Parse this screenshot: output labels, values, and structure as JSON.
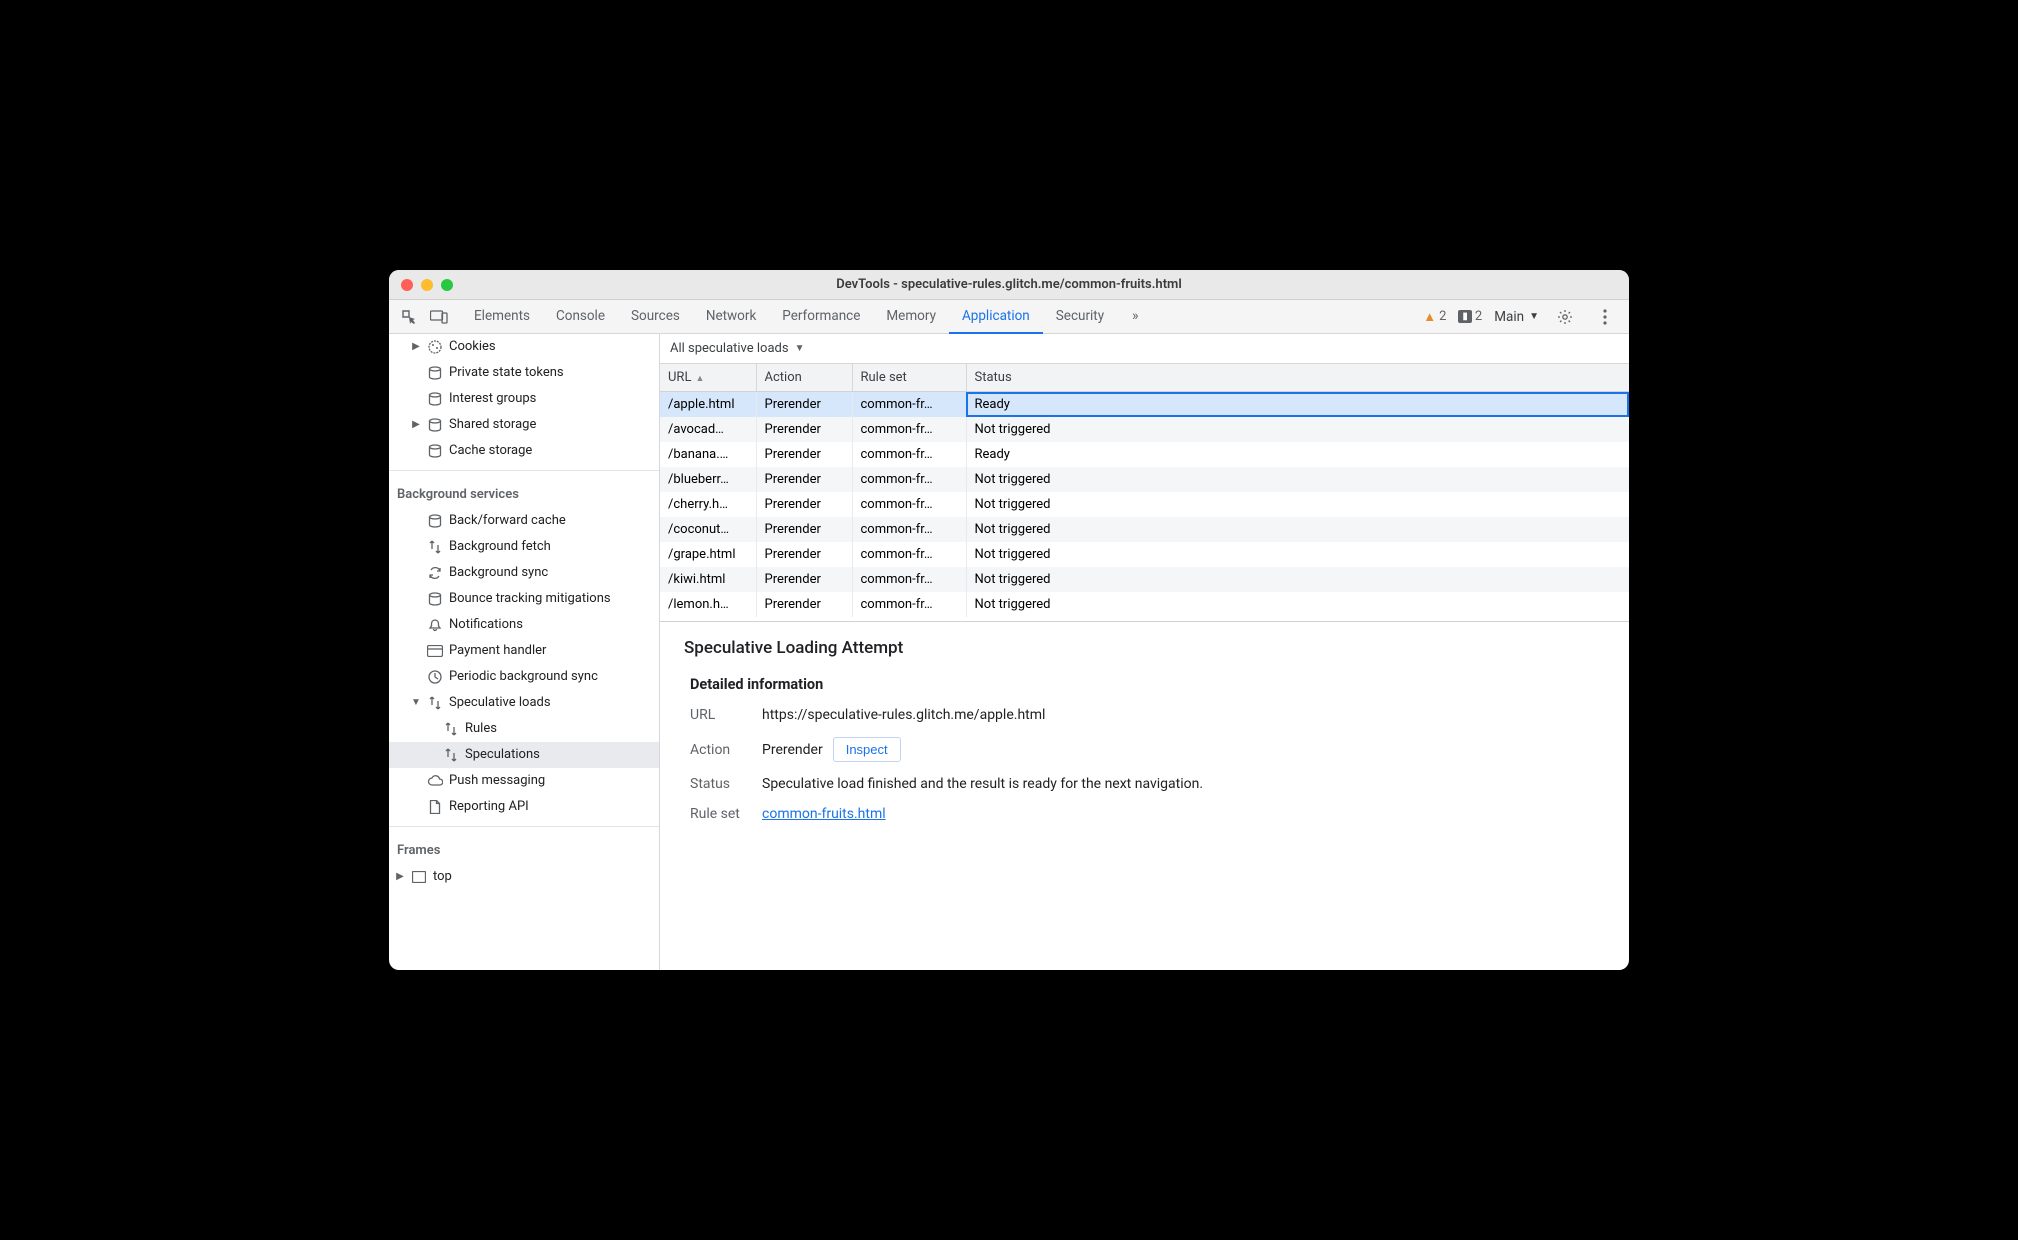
{
  "title": "DevTools - speculative-rules.glitch.me/common-fruits.html",
  "toolbar": {
    "tabs": [
      "Elements",
      "Console",
      "Sources",
      "Network",
      "Performance",
      "Memory",
      "Application",
      "Security"
    ],
    "active_tab": "Application",
    "more_glyph": "»",
    "warnings_count": "2",
    "breakpoints_count": "2",
    "context_label": "Main"
  },
  "sidebar": {
    "storage_items": [
      {
        "label": "Cookies",
        "icon": "cookie",
        "expandable": true
      },
      {
        "label": "Private state tokens",
        "icon": "db"
      },
      {
        "label": "Interest groups",
        "icon": "db"
      },
      {
        "label": "Shared storage",
        "icon": "db",
        "expandable": true
      },
      {
        "label": "Cache storage",
        "icon": "db"
      }
    ],
    "bg_title": "Background services",
    "bg_items": [
      {
        "label": "Back/forward cache",
        "icon": "db"
      },
      {
        "label": "Background fetch",
        "icon": "arrows"
      },
      {
        "label": "Background sync",
        "icon": "sync"
      },
      {
        "label": "Bounce tracking mitigations",
        "icon": "db"
      },
      {
        "label": "Notifications",
        "icon": "bell"
      },
      {
        "label": "Payment handler",
        "icon": "card"
      },
      {
        "label": "Periodic background sync",
        "icon": "clock"
      },
      {
        "label": "Speculative loads",
        "icon": "arrows",
        "expanded": true,
        "children": [
          {
            "label": "Rules",
            "icon": "arrows"
          },
          {
            "label": "Speculations",
            "icon": "arrows",
            "selected": true
          }
        ]
      },
      {
        "label": "Push messaging",
        "icon": "cloud"
      },
      {
        "label": "Reporting API",
        "icon": "doc"
      }
    ],
    "frames_title": "Frames",
    "frames_top": "top"
  },
  "filter": {
    "label": "All speculative loads"
  },
  "columns": {
    "url": "URL",
    "action": "Action",
    "ruleset": "Rule set",
    "status": "Status"
  },
  "rows": [
    {
      "url": "/apple.html",
      "action": "Prerender",
      "ruleset": "common-fr…",
      "status": "Ready",
      "selected": true
    },
    {
      "url": "/avocad…",
      "action": "Prerender",
      "ruleset": "common-fr…",
      "status": "Not triggered"
    },
    {
      "url": "/banana.…",
      "action": "Prerender",
      "ruleset": "common-fr…",
      "status": "Ready"
    },
    {
      "url": "/blueberr…",
      "action": "Prerender",
      "ruleset": "common-fr…",
      "status": "Not triggered"
    },
    {
      "url": "/cherry.h…",
      "action": "Prerender",
      "ruleset": "common-fr…",
      "status": "Not triggered"
    },
    {
      "url": "/coconut…",
      "action": "Prerender",
      "ruleset": "common-fr…",
      "status": "Not triggered"
    },
    {
      "url": "/grape.html",
      "action": "Prerender",
      "ruleset": "common-fr…",
      "status": "Not triggered"
    },
    {
      "url": "/kiwi.html",
      "action": "Prerender",
      "ruleset": "common-fr…",
      "status": "Not triggered"
    },
    {
      "url": "/lemon.h…",
      "action": "Prerender",
      "ruleset": "common-fr…",
      "status": "Not triggered"
    }
  ],
  "details": {
    "title": "Speculative Loading Attempt",
    "subtitle": "Detailed information",
    "labels": {
      "url": "URL",
      "action": "Action",
      "status": "Status",
      "ruleset": "Rule set"
    },
    "url": "https://speculative-rules.glitch.me/apple.html",
    "action": "Prerender",
    "inspect": "Inspect",
    "status": "Speculative load finished and the result is ready for the next navigation.",
    "ruleset": "common-fruits.html"
  }
}
